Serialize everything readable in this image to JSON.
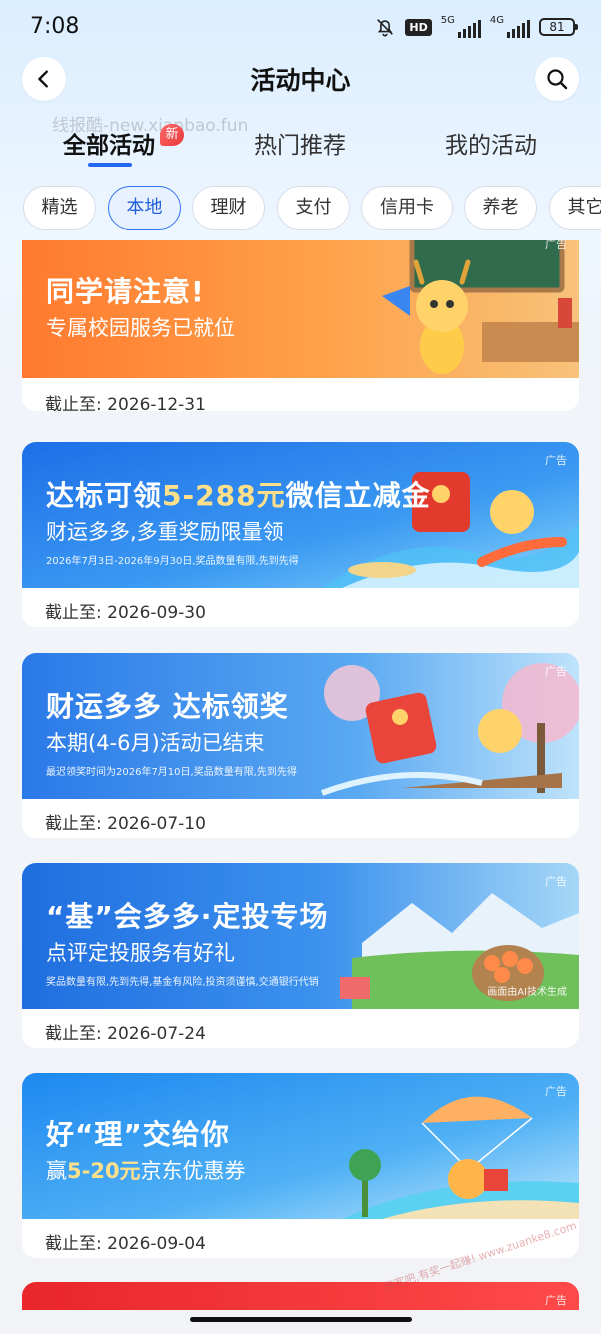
{
  "status_bar": {
    "time": "7:08",
    "hd_label": "HD",
    "network_1": "5G",
    "network_2": "4G",
    "battery": "81",
    "icons": [
      "bell-off-icon",
      "signal-icon",
      "battery-icon"
    ]
  },
  "header": {
    "title": "活动中心",
    "back_icon": "chevron-left-icon",
    "search_icon": "search-icon",
    "watermark": "线报酷-new.xianbao.fun"
  },
  "tabs": [
    {
      "label": "全部活动",
      "active": true,
      "badge": "新"
    },
    {
      "label": "热门推荐",
      "active": false
    },
    {
      "label": "我的活动",
      "active": false
    }
  ],
  "chips": [
    {
      "label": "精选",
      "active": false
    },
    {
      "label": "本地",
      "active": true
    },
    {
      "label": "理财",
      "active": false
    },
    {
      "label": "支付",
      "active": false
    },
    {
      "label": "信用卡",
      "active": false
    },
    {
      "label": "养老",
      "active": false
    },
    {
      "label": "其它",
      "active": false
    }
  ],
  "cards": [
    {
      "title": "同学请注意!",
      "subtitle": "专属校园服务已就位",
      "ad_tag": "广告",
      "deadline": "截止至: 2026-12-31",
      "theme_colors": [
        "#ff7a2f",
        "#ffb25a"
      ]
    },
    {
      "title_pre": "达标可领",
      "title_highlight": "5-288元",
      "title_post": "微信立减金",
      "subtitle": "财运多多,多重奖励限量领",
      "small_print": "2026年7月3日-2026年9月30日,奖品数量有限,先到先得",
      "ad_tag": "广告",
      "deadline": "截止至: 2026-09-30",
      "theme_colors": [
        "#1e6fe8",
        "#4fb4f5"
      ]
    },
    {
      "title": "财运多多 达标领奖",
      "subtitle": "本期(4-6月)活动已结束",
      "small_print": "最迟领奖时间为2026年7月10日,奖品数量有限,先到先得",
      "ad_tag": "广告",
      "deadline": "截止至: 2026-07-10",
      "theme_colors": [
        "#2a79e8",
        "#7ec5f7"
      ]
    },
    {
      "title": "“基”会多多·定投专场",
      "subtitle": "点评定投服务有好礼",
      "small_print": "奖品数量有限,先到先得,基金有风险,投资须谨慎,交通银行代销",
      "ai_note": "画面由AI技术生成",
      "ad_tag": "广告",
      "deadline": "截止至: 2026-07-24",
      "theme_colors": [
        "#1f6ee0",
        "#6fbf5a"
      ]
    },
    {
      "title": "好“理”交给你",
      "subtitle_pre": "赢",
      "subtitle_highlight": "5-20元",
      "subtitle_post": "京东优惠券",
      "ad_tag": "广告",
      "deadline": "截止至: 2026-09-04",
      "theme_colors": [
        "#1d88f0",
        "#8fd2fb"
      ]
    },
    {
      "ad_tag": "广告",
      "theme_colors": [
        "#e8262b",
        "#ff4a4a"
      ]
    }
  ],
  "footer_watermark": "赚客吧,有奖一起赚! www.zuanke8.com"
}
